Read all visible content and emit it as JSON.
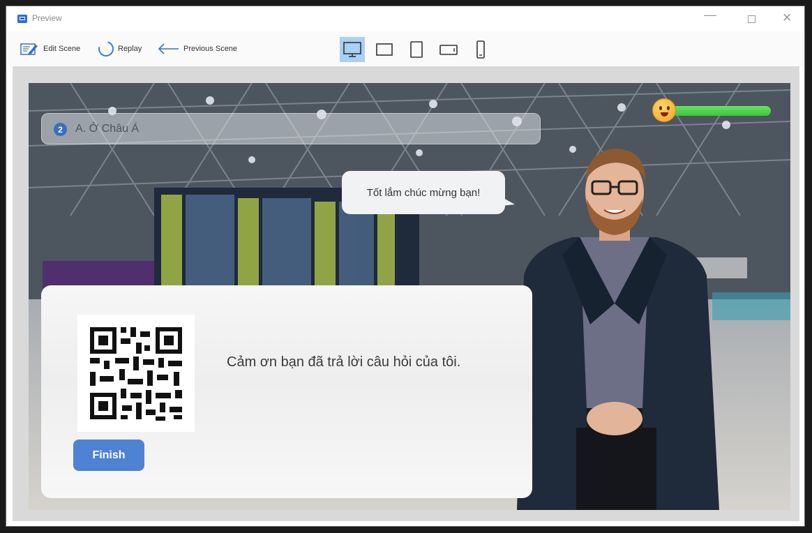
{
  "window": {
    "title": "Preview"
  },
  "toolbar": {
    "edit_label": "Edit Scene",
    "replay_label": "Replay",
    "previous_label": "Previous Scene",
    "devices": [
      "desktop",
      "widescreen",
      "tablet",
      "tablet-landscape",
      "phone"
    ],
    "active_device": "desktop"
  },
  "scene": {
    "question_number": "2",
    "question_text": "A. Ở Châu Á",
    "progress": 1.0,
    "speech_text": "Tốt lắm chúc mừng bạn!",
    "card_message": "Cảm ơn bạn đã trả lời câu hỏi của tôi.",
    "finish_label": "Finish"
  },
  "colors": {
    "accent": "#4f82d2",
    "progress": "#4cd34c",
    "device_active": "#a9d0f5"
  }
}
